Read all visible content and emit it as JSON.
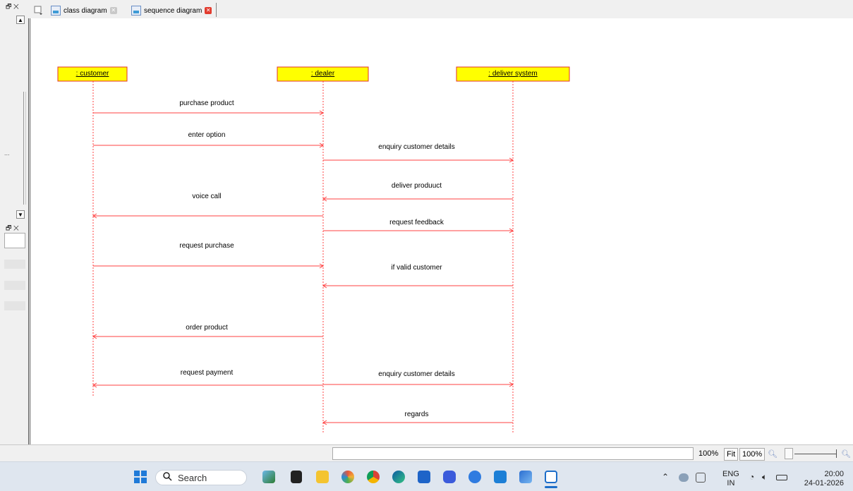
{
  "tabs": [
    {
      "label": "class diagram",
      "active": false
    },
    {
      "label": "sequence diagram",
      "active": true
    }
  ],
  "left_panel": {
    "ellipsis": "..."
  },
  "diagram": {
    "objects": [
      {
        "label": ": customer"
      },
      {
        "label": ": dealer"
      },
      {
        "label": ": deliver system"
      }
    ],
    "messages": [
      {
        "label": "purchase product",
        "from": 0,
        "to": 1
      },
      {
        "label": "enter option",
        "from": 0,
        "to": 1
      },
      {
        "label": "enquiry customer details",
        "from": 1,
        "to": 2
      },
      {
        "label": "deliver produuct",
        "from": 2,
        "to": 1
      },
      {
        "label": "voice call",
        "from": 1,
        "to": 0
      },
      {
        "label": "request feedback",
        "from": 1,
        "to": 2
      },
      {
        "label": "request purchase",
        "from": 0,
        "to": 1
      },
      {
        "label": "if valid customer",
        "from": 2,
        "to": 1
      },
      {
        "label": "order product",
        "from": 1,
        "to": 0
      },
      {
        "label": "request payment",
        "from": 1,
        "to": 0
      },
      {
        "label": "enquiry customer details",
        "from": 1,
        "to": 2
      },
      {
        "label": "regards",
        "from": 2,
        "to": 1
      }
    ],
    "colors": {
      "line": "#ff4040",
      "object_fill": "#ffff00",
      "object_border": "#e0302a",
      "lifeline": "#ff4040"
    }
  },
  "statusbar": {
    "zoom_percent": "100%",
    "fit_label": "Fit",
    "zoom_100_label": "100%"
  },
  "taskbar": {
    "search_placeholder": "Search",
    "language": "ENG",
    "region": "IN",
    "time": "20:00",
    "date": "24-01-2026"
  }
}
